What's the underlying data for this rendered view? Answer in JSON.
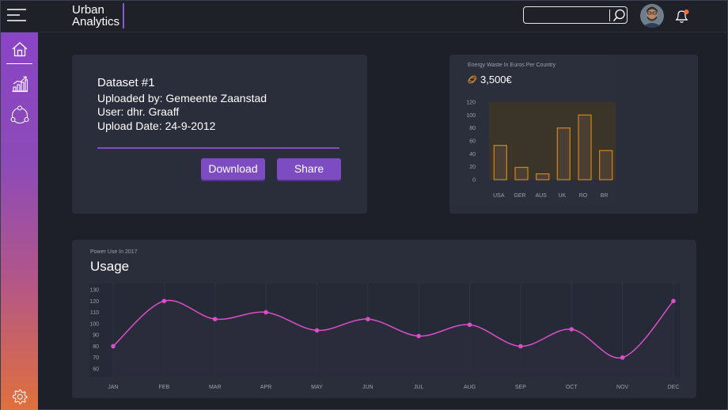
{
  "header": {
    "brand_line1": "Urban",
    "brand_line2": "Analytics",
    "search_placeholder": "",
    "menu_icon": "hamburger-menu-icon",
    "search_icon": "search-icon",
    "notification_icon": "bell-icon",
    "notification_dot_color": "#f26b38"
  },
  "sidebar": {
    "items": [
      {
        "icon": "home-icon",
        "active": true
      },
      {
        "icon": "bar-chart-icon",
        "active": false
      },
      {
        "icon": "network-icon",
        "active": false
      }
    ],
    "footer_icon": "gear-icon"
  },
  "dataset": {
    "title": "Dataset #1",
    "uploaded_by": "Uploaded by: Gemeente Zaanstad",
    "user": "User: dhr. Graaff",
    "upload_date": "Upload Date: 24-9-2012",
    "download_label": "Download",
    "share_label": "Share"
  },
  "energy": {
    "title": "Energy Waste In Euros Per Country",
    "value": "3,500€",
    "icon": "coin-icon"
  },
  "usage": {
    "subtitle": "Power Use In 2017",
    "title": "Usage"
  },
  "colors": {
    "accent": "#7d4cc2",
    "bar_stroke": "#c8801e",
    "bar_fill": "#4a3f32",
    "line": "#d94fc9",
    "background": "#1e2029",
    "card": "#2a2d3a"
  },
  "chart_data": [
    {
      "type": "bar",
      "title": "Energy Waste In Euros Per Country",
      "categories": [
        "USA",
        "GER",
        "AUS",
        "UK",
        "RO",
        "BR"
      ],
      "values": [
        53,
        19,
        9,
        80,
        100,
        45
      ],
      "ylim": [
        0,
        120
      ],
      "yticks": [
        0,
        20,
        40,
        60,
        80,
        100,
        120
      ],
      "grid": false,
      "legend": "none"
    },
    {
      "type": "line",
      "title": "Usage",
      "subtitle": "Power Use In 2017",
      "categories": [
        "JAN",
        "FEB",
        "MAR",
        "APR",
        "MAY",
        "JUN",
        "JUL",
        "AUG",
        "SEP",
        "OCT",
        "NOV",
        "DEC"
      ],
      "values": [
        80,
        120,
        104,
        110,
        94,
        104,
        89,
        99,
        80,
        95,
        70,
        120
      ],
      "ylim": [
        60,
        130
      ],
      "yticks": [
        60,
        70,
        80,
        90,
        100,
        110,
        120,
        130
      ],
      "grid": "vertical",
      "legend": "none"
    }
  ]
}
